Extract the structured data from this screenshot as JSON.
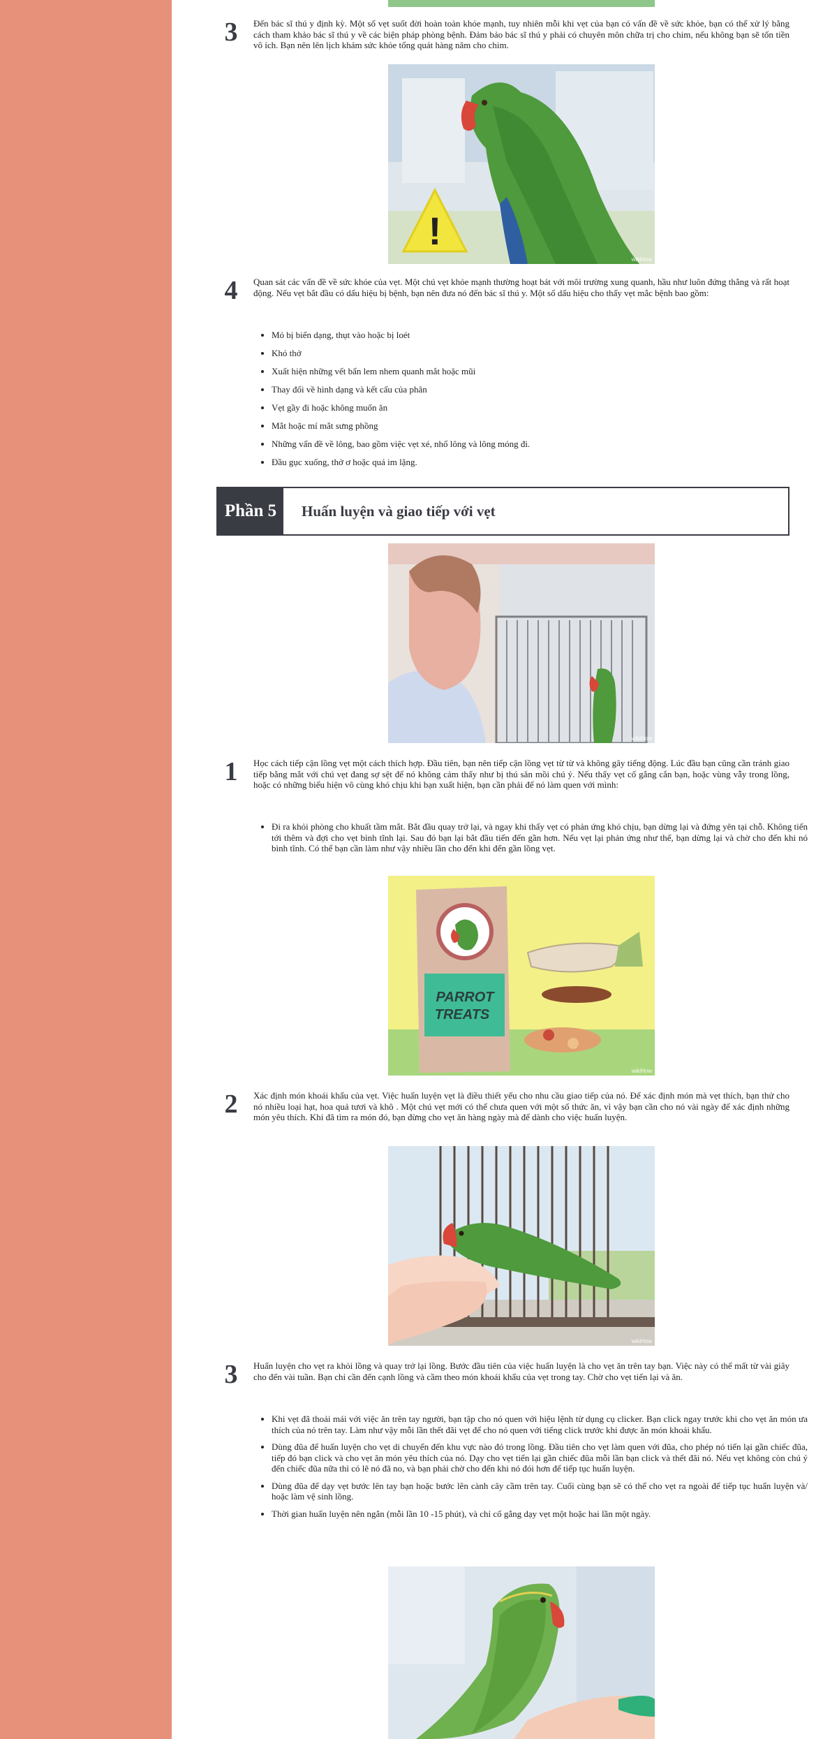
{
  "brand": {
    "watermark": "wikiHow"
  },
  "colors": {
    "side_band": "#e8917a",
    "header_dark": "#3a3c44"
  },
  "steps_prev": [
    {
      "num": "3",
      "text": "Đến bác sĩ thú y định kỳ. Một số vẹt suốt đời hoàn toàn khỏe mạnh, tuy nhiên mỗi khi vẹt của bạn có vấn đề về sức khỏe, bạn có thể xử lý bằng cách tham khảo bác sĩ thú y về các biện pháp phòng bệnh. Đảm bảo bác sĩ thú y phải có chuyên môn chữa trị cho chim, nếu không bạn sẽ tốn tiền vô ích. Bạn nên lên lịch khám sức khỏe tổng quát hàng năm cho chim."
    },
    {
      "num": "4",
      "text": "Quan sát các vấn đề về sức khỏe của vẹt. Một chú vẹt khỏe mạnh thường hoạt bát với môi trường xung quanh, hầu như luôn đứng thẳng và rất hoạt động. Nếu vẹt bắt đầu có dấu hiệu bị bệnh, bạn nên đưa nó đến bác sĩ thú y. Một số dấu hiệu cho thấy vẹt mắc bệnh bao gồm:",
      "bullets": [
        "Mỏ bị biến dạng, thụt vào hoặc bị loét",
        "Khó thở",
        "Xuất hiện những vết bẩn lem nhem quanh mắt hoặc mũi",
        "Thay đổi về hình dạng và kết cấu của phân",
        "Vẹt gầy đi hoặc không muốn ăn",
        "Mắt hoặc mí mắt sưng phồng",
        "Những vấn đề về lông, bao gồm việc vẹt xé, nhổ lông và lông móng đi.",
        "Đầu gục xuống, thở ơ hoặc quá im lặng."
      ]
    }
  ],
  "part": {
    "label": "Phần 5",
    "title": "Huấn luyện và giao tiếp với vẹt"
  },
  "steps": [
    {
      "num": "1",
      "text": "Học cách tiếp cận lồng vẹt một cách thích hợp. Đầu tiên, bạn nên tiếp cận lồng vẹt từ từ và không gây tiếng động. Lúc đầu bạn cũng cần tránh giao tiếp bằng mắt với chú vẹt đang sợ sệt để nó không cảm thấy như bị thú săn mồi chú ý. Nếu thấy vẹt cố gắng cắn bạn, hoặc vùng vẫy trong lồng, hoặc có những biểu hiện vô cùng khó chịu khi bạn xuất hiện, bạn cần phải để nó làm quen với mình:",
      "bullets": [
        "Đi ra khỏi phòng cho khuất tầm mắt. Bắt đầu quay trở lại, và ngay khi thấy vẹt có phản ứng khó chịu, bạn dừng lại và đứng yên tại chỗ. Không tiến tới thêm và đợi cho vẹt bình tĩnh lại. Sau đó bạn lại bắt đầu tiến đến gần hơn. Nếu vẹt lại phản ứng như thế, bạn dừng lại và chờ cho đến khi nó bình tĩnh. Có thể bạn cần làm như vậy nhiều lần cho đến khi đến gần lồng vẹt."
      ]
    },
    {
      "num": "2",
      "text": "Xác định món khoái khẩu của vẹt. Việc huấn luyện vẹt là điều thiết yếu cho nhu cầu giao tiếp của nó. Để xác định món mà vẹt thích, bạn thử cho nó nhiều loại hạt, hoa quả tươi và khô . Một chú vẹt mới có thể chưa quen với một số thức ăn, vì vậy bạn cần cho nó vài ngày để xác định những món yêu thích. Khi đã tìm ra món đó, bạn đừng cho vẹt ăn hàng ngày mà để dành cho việc huấn luyện."
    },
    {
      "num": "3",
      "text": "Huấn luyện cho vẹt ra khỏi lồng và quay trở lại lồng. Bước đầu tiên của việc huấn luyện là cho vẹt ăn trên tay bạn. Việc này có thể mất từ vài giây cho đến vài tuần. Bạn chỉ cần đến cạnh lồng và cầm theo món khoái khẩu của vẹt trong tay. Chờ cho vẹt tiến lại và ăn.",
      "bullets": [
        "Khi vẹt đã thoải mái với việc ăn trên tay người, bạn tập cho nó quen với hiệu lệnh từ dụng cụ clicker. Bạn click ngay trước khi cho vẹt ăn món ưa thích của nó trên tay. Làm như vậy mỗi lần thết đãi vẹt để cho nó quen với tiếng click trước khi được ăn món khoái khẩu.",
        "Dùng đũa để huấn luyện cho vẹt di chuyển đến khu vực nào đó trong lồng. Đầu tiên cho vẹt làm quen với đũa, cho phép nó tiến lại gần chiếc đũa, tiếp đó bạn click và cho vẹt ăn món yêu thích của nó. Dạy cho vẹt tiến lại gần chiếc đũa mỗi lần bạn click và thết đãi nó. Nếu vẹt không còn chú ý đến chiếc đũa nữa thì có lẽ nó đã no, và bạn phải chờ cho đến khi nó đói hơn để tiếp tục huấn luyện.",
        "Dùng đũa để dạy vẹt bước lên tay bạn hoặc bước lên cành cây cầm trên tay. Cuối cùng bạn sẽ có thể cho vẹt ra ngoài để tiếp tục huấn luyện và/ hoặc làm vệ sinh lồng.",
        "Thời gian huấn luyện nên ngắn (mỗi lần 10 -15 phút), và chỉ cố gắng dạy vẹt một hoặc hai lần một ngày."
      ]
    }
  ],
  "images": {
    "img1": {
      "icon": "warning-icon",
      "sign": "!"
    },
    "img3": {
      "bag_line1": "PARROT",
      "bag_line2": "TREATS"
    }
  }
}
